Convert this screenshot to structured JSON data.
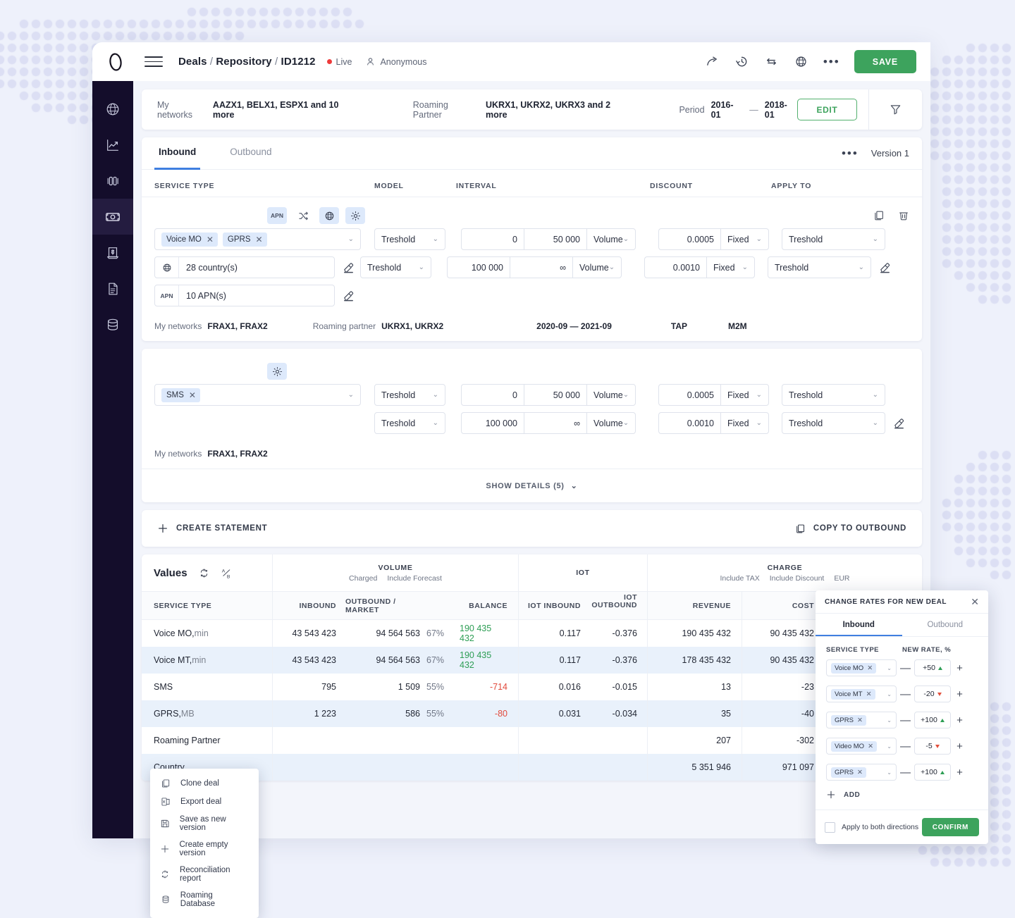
{
  "header": {
    "breadcrumb": {
      "deals": "Deals",
      "repository": "Repository",
      "id": "ID1212"
    },
    "status": "Live",
    "user": "Anonymous",
    "save_label": "SAVE",
    "icons": [
      "share-icon",
      "history-icon",
      "exchange-icon",
      "globe-icon",
      "more-icon"
    ]
  },
  "filters": {
    "my_networks_label": "My networks",
    "my_networks_value": "AAZX1, BELX1, ESPX1 and 10 more",
    "roaming_partner_label": "Roaming Partner",
    "roaming_partner_value": "UKRX1, UKRX2, UKRX3 and  2 more",
    "period_label": "Period",
    "period_from": "2016-01",
    "period_dash": "—",
    "period_to": "2018-01",
    "edit_label": "EDIT"
  },
  "sidebar": {
    "items": [
      {
        "name": "globe-icon",
        "active": false
      },
      {
        "name": "analytics-icon",
        "active": false
      },
      {
        "name": "compare-icon",
        "active": false
      },
      {
        "name": "money-icon",
        "active": true
      },
      {
        "name": "invoice-icon",
        "active": false
      },
      {
        "name": "document-icon",
        "active": false
      },
      {
        "name": "database-icon",
        "active": false
      }
    ]
  },
  "deal": {
    "tabs": [
      {
        "label": "Inbound",
        "active": true
      },
      {
        "label": "Outbound",
        "active": false
      }
    ],
    "version_label": "Version 1",
    "columns": {
      "service_type": "SERVICE TYPE",
      "model": "MODEL",
      "interval": "INTERVAL",
      "discount": "DISCOUNT",
      "apply_to": "APPLY TO"
    },
    "statements": [
      {
        "toolbar": [
          {
            "label": "APN",
            "name": "apn-toggle",
            "active": true
          },
          {
            "label": "",
            "name": "shuffle-icon",
            "active": false
          },
          {
            "label": "",
            "name": "globe-icon",
            "active": true
          },
          {
            "label": "",
            "name": "gear-icon",
            "active": true
          }
        ],
        "tags": [
          "Voice MO",
          "GPRS"
        ],
        "geo": {
          "prefix": "globe-icon",
          "value": "28 country(s)"
        },
        "apn": {
          "prefix": "APN",
          "value": "10 APN(s)"
        },
        "rows": [
          {
            "model": "Treshold",
            "from": "0",
            "to": "50 000",
            "unit": "Volume",
            "discount": "0.0005",
            "dtype": "Fixed",
            "apply": "Treshold"
          },
          {
            "model": "Treshold",
            "from": "100 000",
            "to": "∞",
            "unit": "Volume",
            "discount": "0.0010",
            "dtype": "Fixed",
            "apply": "Treshold"
          }
        ],
        "meta": {
          "my_networks_label": "My networks",
          "my_networks_value": "FRAX1, FRAX2",
          "roaming_partner_label": "Roaming partner",
          "roaming_partner_value": "UKRX1, UKRX2",
          "period": "2020-09 — 2021-09",
          "tap": "TAP",
          "m2m": "M2M"
        }
      },
      {
        "toolbar": [
          {
            "label": "",
            "name": "gear-icon",
            "active": true
          }
        ],
        "tags": [
          "SMS"
        ],
        "rows": [
          {
            "model": "Treshold",
            "from": "0",
            "to": "50 000",
            "unit": "Volume",
            "discount": "0.0005",
            "dtype": "Fixed",
            "apply": "Treshold"
          },
          {
            "model": "Treshold",
            "from": "100 000",
            "to": "∞",
            "unit": "Volume",
            "discount": "0.0010",
            "dtype": "Fixed",
            "apply": "Treshold"
          }
        ],
        "meta": {
          "my_networks_label": "My networks",
          "my_networks_value": "FRAX1, FRAX2"
        }
      }
    ],
    "show_details": "SHOW DETAILS (5)",
    "create_statement": "CREATE STATEMENT",
    "copy_to_outbound": "COPY TO OUTBOUND"
  },
  "values_table": {
    "title": "Values",
    "group_headers": [
      {
        "title": "VOLUME",
        "subs": [
          "Charged",
          "Include Forecast"
        ]
      },
      {
        "title": "IOT",
        "subs": []
      },
      {
        "title": "CHARGE",
        "subs": [
          "Include TAX",
          "Include Discount",
          "EUR"
        ]
      }
    ],
    "columns": [
      "SERVICE TYPE",
      "INBOUND",
      "OUTBOUND / MARKET",
      "BALANCE",
      "IOT INBOUND",
      "IOT OUTBOUND",
      "REVENUE",
      "COST"
    ],
    "rows": [
      {
        "service": "Voice MO",
        "unit": "min",
        "inbound": "43 543 423",
        "outbound": "94 564 563",
        "pct": "67%",
        "balance": "190 435 432",
        "balance_sign": "pos",
        "iot_in": "0.117",
        "iot_out": "-0.376",
        "revenue": "190 435 432",
        "cost": "90 435 432"
      },
      {
        "service": "Voice MT",
        "unit": "min",
        "inbound": "43 543 423",
        "outbound": "94 564 563",
        "pct": "67%",
        "balance": "190 435 432",
        "balance_sign": "pos",
        "iot_in": "0.117",
        "iot_out": "-0.376",
        "revenue": "178 435 432",
        "cost": "90 435 432"
      },
      {
        "service": "SMS",
        "unit": "",
        "inbound": "795",
        "outbound": "1 509",
        "pct": "55%",
        "balance": "-714",
        "balance_sign": "neg",
        "iot_in": "0.016",
        "iot_out": "-0.015",
        "revenue": "13",
        "cost": "-23"
      },
      {
        "service": "GPRS",
        "unit": "MB",
        "inbound": "1 223",
        "outbound": "586",
        "pct": "55%",
        "balance": "-80",
        "balance_sign": "neg",
        "iot_in": "0.031",
        "iot_out": "-0.034",
        "revenue": "35",
        "cost": "-40"
      },
      {
        "service": "Roaming Partner",
        "unit": "",
        "inbound": "",
        "outbound": "",
        "pct": "",
        "balance": "",
        "balance_sign": "none",
        "iot_in": "",
        "iot_out": "",
        "revenue": "207",
        "cost": "-302"
      },
      {
        "service": "Country",
        "unit": "",
        "inbound": "",
        "outbound": "",
        "pct": "",
        "balance": "",
        "balance_sign": "none",
        "iot_in": "",
        "iot_out": "",
        "revenue": "5 351 946",
        "cost": "971 097"
      }
    ]
  },
  "context_menu": {
    "items": [
      {
        "label": "Clone deal",
        "icon": "clone-icon"
      },
      {
        "label": "Export deal",
        "icon": "export-icon"
      },
      {
        "label": "Save as new version",
        "icon": "save-icon"
      },
      {
        "label": "Create empty version",
        "icon": "plus-icon"
      },
      {
        "label": "Reconciliation report",
        "icon": "reconcile-icon"
      },
      {
        "label": "Roaming Database",
        "icon": "database-icon"
      }
    ]
  },
  "rate_panel": {
    "title": "CHANGE RATES FOR NEW DEAL",
    "tabs": [
      {
        "label": "Inbound",
        "active": true
      },
      {
        "label": "Outbound",
        "active": false
      }
    ],
    "col_service": "SERVICE TYPE",
    "col_rate": "NEW RATE, %",
    "rows": [
      {
        "service": "Voice MO",
        "rate": "+50",
        "dir": "up"
      },
      {
        "service": "Voice MT",
        "rate": "-20",
        "dir": "down"
      },
      {
        "service": "GPRS",
        "rate": "+100",
        "dir": "up"
      },
      {
        "service": "Video MO",
        "rate": "-5",
        "dir": "down"
      },
      {
        "service": "GPRS",
        "rate": "+100",
        "dir": "up"
      }
    ],
    "add_label": "ADD",
    "apply_both_label": "Apply to both directions",
    "confirm_label": "CONFIRM"
  },
  "colors": {
    "accent_green": "#3da35d",
    "accent_blue": "#3f7fe0",
    "positive": "#2e9e55",
    "negative": "#e24a3c",
    "rail_bg": "#140d2b"
  }
}
